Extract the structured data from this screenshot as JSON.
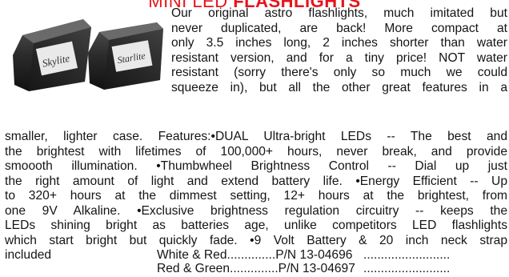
{
  "heading": {
    "prefix": "MINI LED ",
    "bold": "FLASHLIGHTS"
  },
  "image": {
    "label_left": "Skylite",
    "label_right": "Starlite",
    "case_color": "#2b2b2b"
  },
  "intro_lines": [
    "Our original astro flashlights, much imitated but",
    "never duplicated, are back! More compact at",
    "only 3.5 inches long, 2 inches shorter than water",
    "resistant version, and for a tiny price! NOT water",
    "resistant (sorry there's only so much we could",
    "squeeze in), but all the other great features in a"
  ],
  "body_lines": [
    "smaller, lighter case. Features:•DUAL Ultra-bright LEDs -- The best and",
    "the brightest with lifetimes of 100,000+ hours, never break, and provide",
    "smoooth illumination.  •Thumbwheel Brightness Control -- Dial up just",
    "the right amount of light and extend battery life.  •Energy Efficient -- Up",
    "to 320+ hours at the dimmest setting, 12+ hours at the brightest, from",
    "one 9V Alkaline.  •Exclusive brightness regulation circuitry -- keeps the",
    "LEDs shining bright as batteries age, unlike competitors LED flashlights",
    "which start bright but quickly fade.  •9 Volt Battery & 20 inch neck strap"
  ],
  "included": "included",
  "parts": [
    {
      "label": "White & Red",
      "pn": "P/N 13-04696",
      "dots_a": "..............",
      "dots_b": "........................."
    },
    {
      "label": "Red & Green",
      "pn": "P/N 13-04697",
      "dots_a": "..............",
      "dots_b": "........................."
    }
  ],
  "colors": {
    "heading": "#e8141b",
    "text": "#141414"
  }
}
